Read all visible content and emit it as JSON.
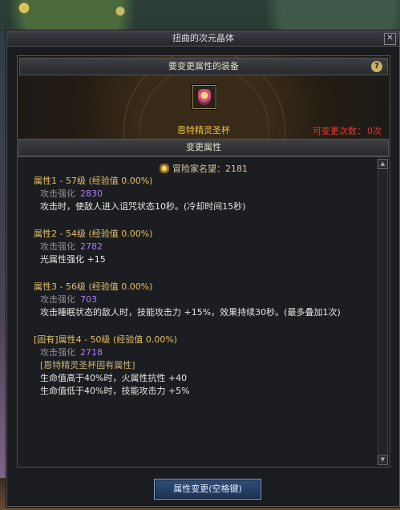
{
  "window": {
    "title": "扭曲的次元晶体"
  },
  "equip": {
    "header": "要变更属性的装备",
    "item_name": "恩特精灵圣杯",
    "change_count_label": "可变更次数：",
    "change_count_value": "0次"
  },
  "attr_section": {
    "header": "变更属性"
  },
  "fame": {
    "label": "冒险家名望：",
    "value": "2181"
  },
  "attributes": [
    {
      "title": "属性1 - 57级 (经验值 0.00%)",
      "attack_label": "攻击强化",
      "attack_value": "2830",
      "effects": [
        "攻击时，使敌人进入诅咒状态10秒。(冷却时间15秒)"
      ]
    },
    {
      "title": "属性2 - 54级 (经验值 0.00%)",
      "attack_label": "攻击强化",
      "attack_value": "2782",
      "effects": [
        "光属性强化 +15"
      ]
    },
    {
      "title": "属性3 - 56级 (经验值 0.00%)",
      "attack_label": "攻击强化",
      "attack_value": "703",
      "effects": [
        "攻击睡眠状态的敌人时，技能攻击力 +15%，效果持续30秒。(最多叠加1次)"
      ]
    },
    {
      "title": "[固有]属性4 - 50级 (经验值 0.00%)",
      "attack_label": "攻击强化",
      "attack_value": "2718",
      "fixed_label": "[恩特精灵圣杯固有属性]",
      "effects": [
        "生命值高于40%时，火属性抗性 +40",
        "生命值低于40%时，技能攻击力 +5%"
      ]
    }
  ],
  "button": {
    "label": "属性变更(空格键)"
  },
  "colors": {
    "attr_title": "#e2c06a",
    "attack_value": "#b07cff",
    "item_name": "#e9c24a",
    "change_count": "#e63a2a"
  },
  "icons": {
    "close": "close-icon",
    "help": "help-icon",
    "fame": "fame-icon",
    "item": "chalice-icon"
  }
}
